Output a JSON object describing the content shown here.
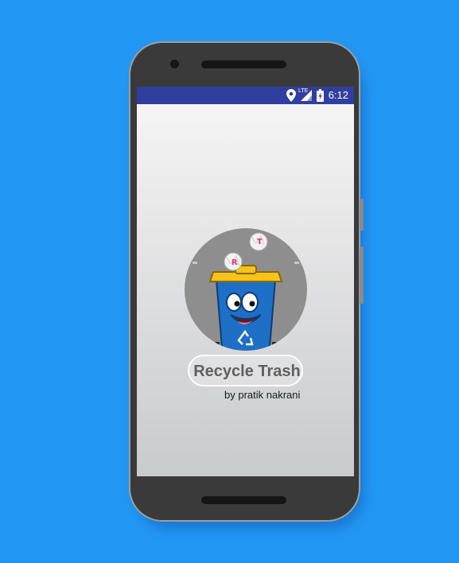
{
  "device": {
    "frame_color": "#3a3a3a",
    "background_color": "#2196f3"
  },
  "statusbar": {
    "network_label": "LTE",
    "time": "6:12",
    "color": "#303f9f",
    "icons": [
      "location-icon",
      "signal-icon",
      "battery-icon"
    ]
  },
  "splash": {
    "app_title": "Recycle Trash",
    "byline": "by pratik nakrani",
    "logo_letters": [
      "R",
      "T"
    ],
    "bin_color": "#1e6fc6",
    "lid_color": "#f6c21c"
  }
}
